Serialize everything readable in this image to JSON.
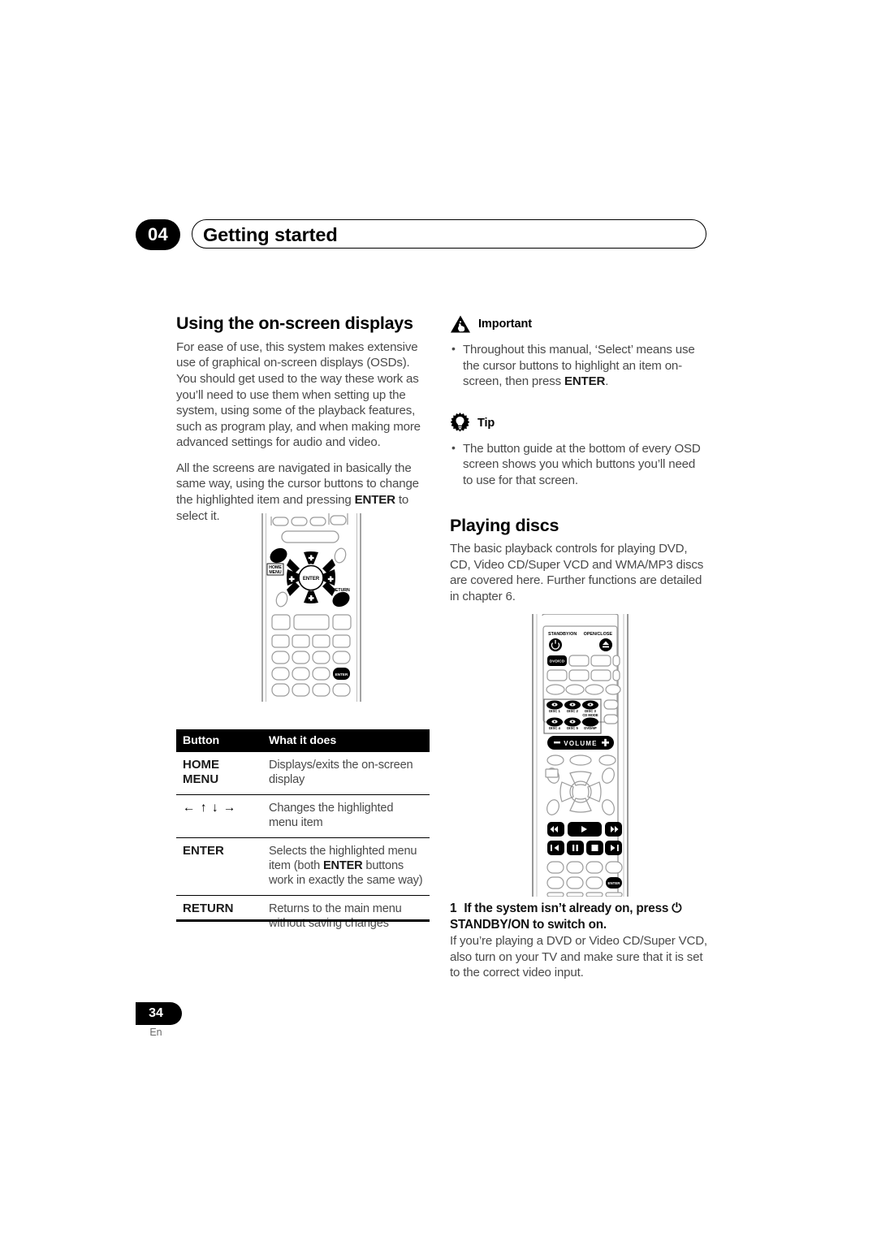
{
  "header": {
    "chapter_number": "04",
    "chapter_title": "Getting started"
  },
  "left_column": {
    "section_title": "Using the on-screen displays",
    "paragraph_1": "For ease of use, this system makes extensive use of graphical on-screen displays (OSDs). You should get used to the way these work as you’ll need to use them when setting up the system, using some of the playback features, such as program play, and when making more advanced settings for audio and video.",
    "paragraph_2_part1": "All the screens are navigated in basically the same way, using the cursor buttons to change the highlighted item and pressing ",
    "paragraph_2_bold": "ENTER",
    "paragraph_2_part2": " to select it."
  },
  "button_table": {
    "headers": [
      "Button",
      "What it does"
    ],
    "rows": [
      {
        "button": "HOME MENU",
        "button_line1": "HOME",
        "button_line2": "MENU",
        "description": "Displays/exits the on-screen display"
      },
      {
        "button": "← ↑ ↓ →",
        "description": "Changes the highlighted menu item"
      },
      {
        "button": "ENTER",
        "description_part1": "Selects the highlighted menu item (both ",
        "description_bold": "ENTER",
        "description_part2": " buttons work in exactly the same way)"
      },
      {
        "button": "RETURN",
        "description": "Returns to the main menu without saving changes"
      }
    ]
  },
  "right_column": {
    "important": {
      "icon": "warning-triangle-hand-icon",
      "label": "Important",
      "bullets": [
        {
          "part1": "Throughout this manual, ‘Select’ means use the cursor buttons to highlight an item on-screen, then press ",
          "bold": "ENTER",
          "part2": "."
        }
      ]
    },
    "tip": {
      "icon": "lightbulb-gear-icon",
      "label": "Tip",
      "bullets": [
        {
          "part1": "The button guide at the bottom of every OSD screen shows you which buttons you’ll need to use for that screen.",
          "bold": "",
          "part2": ""
        }
      ]
    },
    "playing_discs": {
      "section_title": "Playing discs",
      "paragraph": "The basic playback controls for playing DVD, CD, Video CD/Super VCD and WMA/MP3 discs are covered here. Further functions are detailed in chapter 6."
    },
    "step": {
      "number": "1",
      "heading_part1": "If the system isn’t already on, press ",
      "heading_symbol": "⏻",
      "heading_part2": " STANDBY/ON to switch on.",
      "body": "If you’re playing a DVD or Video CD/Super VCD, also turn on your TV and make sure that it is set to the correct video input."
    }
  },
  "remote_osd": {
    "alt": "remote control illustration highlighting HOME MENU, cursor pad, ENTER and RETURN buttons",
    "labels": {
      "home_menu": "HOME MENU",
      "home_menu_line1": "HOME",
      "home_menu_line2": "MENU",
      "return": "RETURN",
      "enter": "ENTER",
      "enter_keypad": "ENTER"
    }
  },
  "remote_play": {
    "alt": "remote control illustration highlighting STANDBY/ON, disc select and transport buttons",
    "labels": {
      "standby_on": "STANDBY/ON",
      "open_close": "OPEN/CLOSE",
      "dvd_cd": "DVD/CD",
      "disc1": "DISC 1",
      "disc2": "DISC 2",
      "disc3": "DISC 3",
      "cd_mode": "CD MODE",
      "disc4": "DISC 4",
      "disc5": "DISC 5",
      "dvd_6p": "DVD/6P",
      "volume": "VOLUME",
      "volume_minus": "−",
      "volume_plus": "+",
      "enter_keypad": "ENTER"
    }
  },
  "footer": {
    "page_number": "34",
    "language": "En"
  },
  "colors": {
    "text_body": "#4a4a4a",
    "text_heading": "#000000",
    "accent_black": "#000000",
    "page_background": "#ffffff"
  }
}
